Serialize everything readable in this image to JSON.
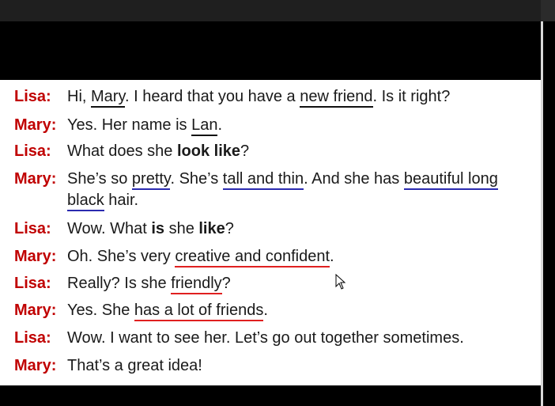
{
  "dialogue": [
    {
      "speaker": "Lisa:",
      "parts": [
        "Hi, ",
        "Mary",
        ". I heard that you have a ",
        "new friend",
        ". Is it right?"
      ]
    },
    {
      "speaker": "Mary:",
      "parts": [
        "Yes. Her name is ",
        "Lan",
        "."
      ]
    },
    {
      "speaker": "Lisa:",
      "parts": [
        "What does she ",
        "look like",
        "?"
      ]
    },
    {
      "speaker": "Mary:",
      "parts": [
        "She’s so ",
        "pretty",
        ". She’s ",
        "tall and thin",
        ". And she has ",
        "beautiful long",
        "black",
        " hair."
      ]
    },
    {
      "speaker": "Lisa:",
      "parts": [
        "Wow. What ",
        "is",
        " she ",
        "like",
        "?"
      ]
    },
    {
      "speaker": "Mary:",
      "parts": [
        "Oh. She’s very ",
        "creative and confident",
        "."
      ]
    },
    {
      "speaker": "Lisa:",
      "parts": [
        "Really? Is she ",
        "friendly",
        "?"
      ]
    },
    {
      "speaker": "Mary:",
      "parts": [
        "Yes. She ",
        "has a lot of friends",
        "."
      ]
    },
    {
      "speaker": "Lisa:",
      "parts": [
        "Wow. I want to see her. Let’s go out together sometimes."
      ]
    },
    {
      "speaker": "Mary:",
      "parts": [
        "That’s a great idea!"
      ]
    }
  ],
  "colors": {
    "speaker": "#c00000",
    "underline_black": "#111111",
    "underline_blue": "#2b2bb0",
    "underline_red": "#e02020"
  },
  "icons": {
    "cursor": "mouse-pointer-icon"
  }
}
